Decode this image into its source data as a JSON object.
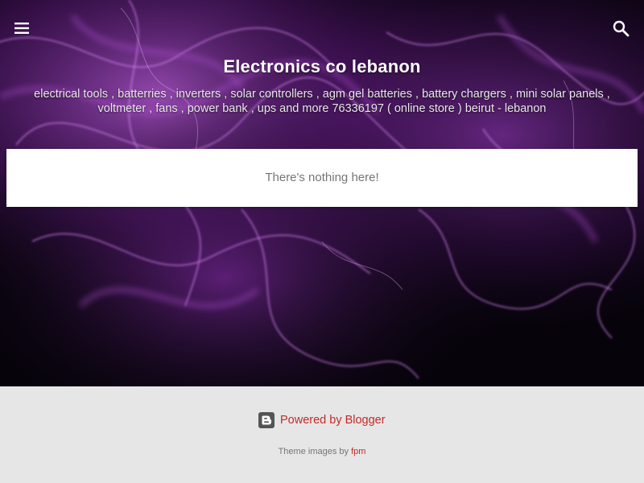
{
  "header": {
    "title": "Electronics co lebanon",
    "description": "electrical tools , batterries , inverters , solar controllers , agm gel batteries , battery chargers , mini solar panels , voltmeter , fans , power bank , ups and more 76336197 ( online store ) beirut - lebanon",
    "menu_icon": "menu-icon",
    "search_icon": "search-icon"
  },
  "main": {
    "empty_message": "There's nothing here!"
  },
  "footer": {
    "powered_label": "Powered by Blogger",
    "blogger_icon": "blogger-icon",
    "theme_credit_prefix": "Theme images by",
    "theme_credit_link": "fpm"
  },
  "colors": {
    "hero_background": "#06030a",
    "smoke_purple": "#b14fd8",
    "footer_background": "#e6e6e6",
    "link_red": "#c62828",
    "card_background": "#ffffff"
  }
}
